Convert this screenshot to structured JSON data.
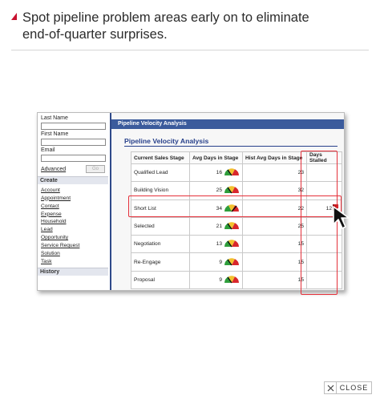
{
  "headline": {
    "line1": "Spot pipeline problem areas early on to eliminate",
    "line2": "end-of-quarter surprises."
  },
  "sidebar": {
    "last_name_label": "Last Name",
    "first_name_label": "First Name",
    "email_label": "Email",
    "advanced_label": "Advanced",
    "go_label": "Go",
    "create_heading": "Create",
    "create_items": [
      "Account",
      "Appointment",
      "Contact",
      "Expense",
      "Household",
      "Lead",
      "Opportunity",
      "Service Request",
      "Solution",
      "Task"
    ],
    "history_heading": "History"
  },
  "content": {
    "bar_title": "Pipeline Velocity Analysis",
    "section_title": "Pipeline Velocity Analysis"
  },
  "table": {
    "headers": [
      "Current Sales Stage",
      "Avg Days in Stage",
      "Hist Avg Days in Stage",
      "Days Stalled"
    ],
    "rows": [
      {
        "stage": "Qualified Lead",
        "avg": "16",
        "hist": "23",
        "stalled": "",
        "gauge": "green"
      },
      {
        "stage": "Building Vision",
        "avg": "25",
        "hist": "32",
        "stalled": "",
        "gauge": "green"
      },
      {
        "stage": "Short List",
        "avg": "34",
        "hist": "22",
        "stalled": "12",
        "gauge": "red"
      },
      {
        "stage": "Selected",
        "avg": "21",
        "hist": "25",
        "stalled": "",
        "gauge": "green"
      },
      {
        "stage": "Negotiation",
        "avg": "13",
        "hist": "15",
        "stalled": "",
        "gauge": "green"
      },
      {
        "stage": "Re-Engage",
        "avg": "9",
        "hist": "15",
        "stalled": "",
        "gauge": "green"
      },
      {
        "stage": "Proposal",
        "avg": "9",
        "hist": "15",
        "stalled": "",
        "gauge": "green"
      }
    ]
  },
  "close_button": {
    "label": "CLOSE"
  },
  "colors": {
    "accent": "#c8102e",
    "bar": "#3b5b9c",
    "highlight": "#e5303a",
    "title": "#27408b"
  }
}
